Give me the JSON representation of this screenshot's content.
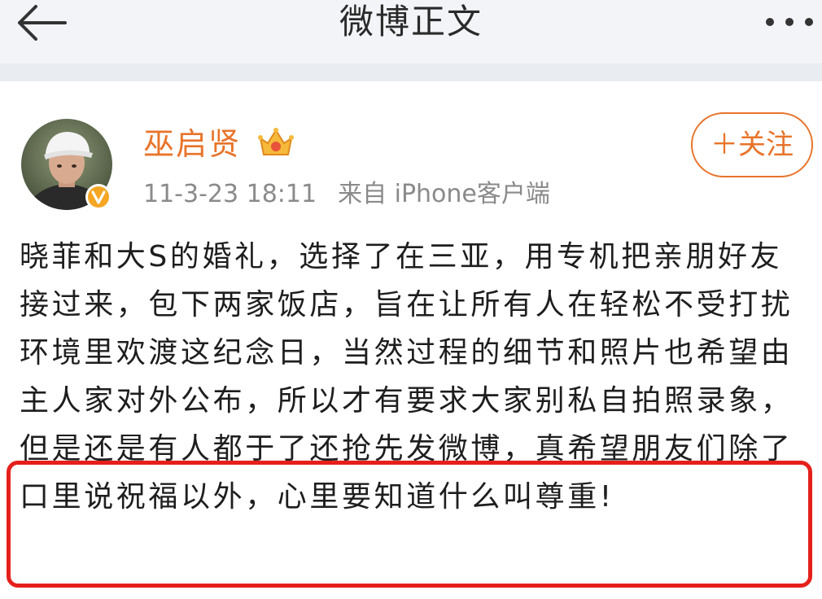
{
  "header": {
    "title": "微博正文",
    "back_icon": "back-arrow-icon",
    "more_icon": "more-dots-icon"
  },
  "post": {
    "author": {
      "name": "巫启贤",
      "avatar": "avatar",
      "verified_icon": "verified-badge-icon",
      "vip_icon": "crown-badge-icon"
    },
    "meta": {
      "timestamp": "11-3-23 18:11",
      "source": "来自 iPhone客户端"
    },
    "follow_label": "＋关注",
    "body": "晓菲和大S的婚礼，选择了在三亚，用专机把亲朋好友接过来，包下两家饭店，旨在让所有人在轻松不受打扰环境里欢渡这纪念日，当然过程的细节和照片也希望由主人家对外公布，所以才有要求大家别私自拍照录象，但是还是有人都于了还抢先发微博，真希望朋友们除了口里说祝福以外，心里要知道什么叫尊重!"
  },
  "colors": {
    "accent": "#e8742a",
    "highlight": "#e5201b",
    "header_bg": "#f2f4f7",
    "meta_text": "#8a8a8a"
  }
}
